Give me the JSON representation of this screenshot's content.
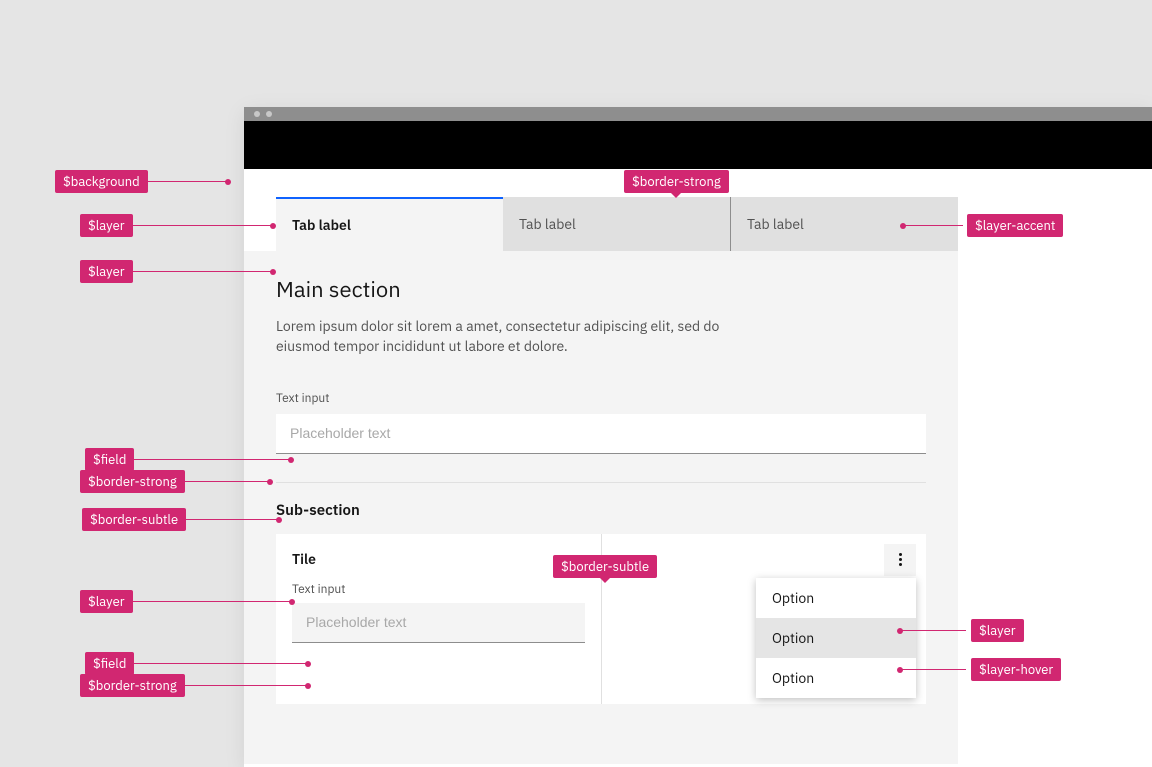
{
  "tabs": [
    {
      "label": "Tab label",
      "active": true
    },
    {
      "label": "Tab label",
      "active": false
    },
    {
      "label": "Tab label",
      "active": false
    }
  ],
  "main": {
    "title": "Main section",
    "body": "Lorem ipsum dolor sit lorem a amet, consectetur adipiscing elit, sed do eiusmod tempor incididunt ut labore et dolore.",
    "input_label": "Text input",
    "input_placeholder": "Placeholder text"
  },
  "sub": {
    "title": "Sub-section",
    "tile_title": "Tile",
    "input_label": "Text input",
    "input_placeholder": "Placeholder text"
  },
  "menu": {
    "items": [
      "Option",
      "Option",
      "Option"
    ]
  },
  "tokens": {
    "background": "$background",
    "layer": "$layer",
    "layer_accent": "$layer-accent",
    "layer_hover": "$layer-hover",
    "field": "$field",
    "border_strong": "$border-strong",
    "border_subtle": "$border-subtle"
  }
}
